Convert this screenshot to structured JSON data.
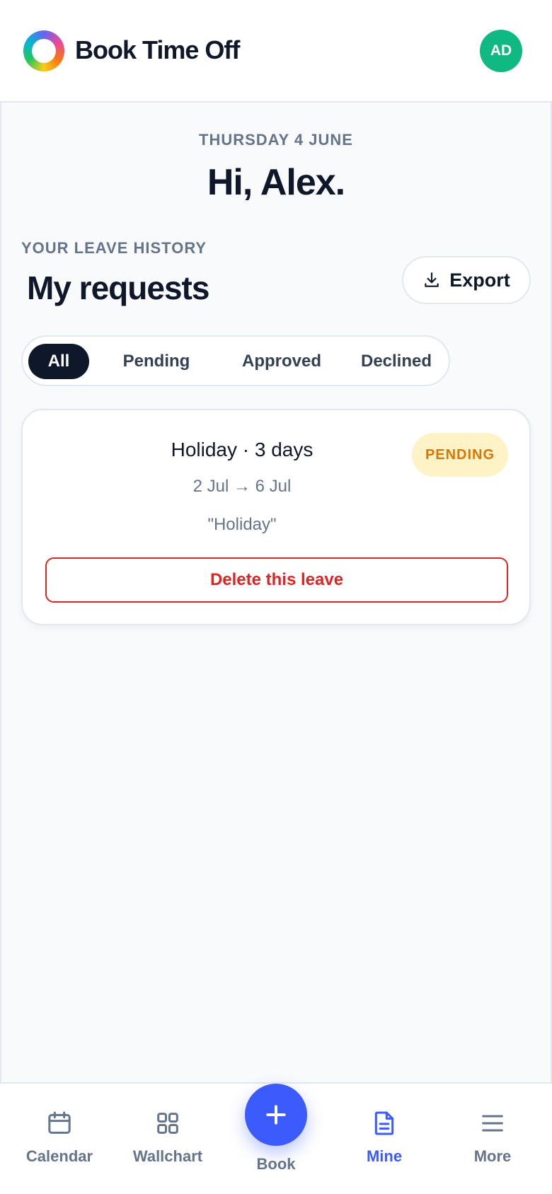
{
  "header": {
    "app_title": "Book Time Off",
    "avatar_initials": "AD",
    "logo_icon": "logo-ring-icon",
    "avatar_color": "#10b981"
  },
  "greeting": {
    "date": "THURSDAY 4 JUNE",
    "text": "Hi, Alex."
  },
  "section": {
    "eyebrow": "YOUR LEAVE HISTORY",
    "title": "My requests",
    "export_label": "Export",
    "export_icon": "download-icon"
  },
  "filters": {
    "tabs": [
      {
        "label": "All",
        "active": true
      },
      {
        "label": "Pending",
        "active": false
      },
      {
        "label": "Approved",
        "active": false
      },
      {
        "label": "Declined",
        "active": false
      }
    ]
  },
  "requests": [
    {
      "title": "Holiday · 3 days",
      "dates": "2 Jul → 6 Jul",
      "note": "\"Holiday\"",
      "status": "PENDING",
      "status_color": "#d97706",
      "delete_label": "Delete this leave"
    }
  ],
  "bottom_nav": {
    "items": [
      {
        "label": "Calendar",
        "icon": "calendar-icon",
        "active": false
      },
      {
        "label": "Wallchart",
        "icon": "grid-icon",
        "active": false
      },
      {
        "label": "Mine",
        "icon": "document-icon",
        "active": true
      },
      {
        "label": "More",
        "icon": "menu-icon",
        "active": false
      }
    ],
    "book_label": "Book",
    "book_icon": "plus-icon",
    "accent_color": "#3b5bfd"
  }
}
